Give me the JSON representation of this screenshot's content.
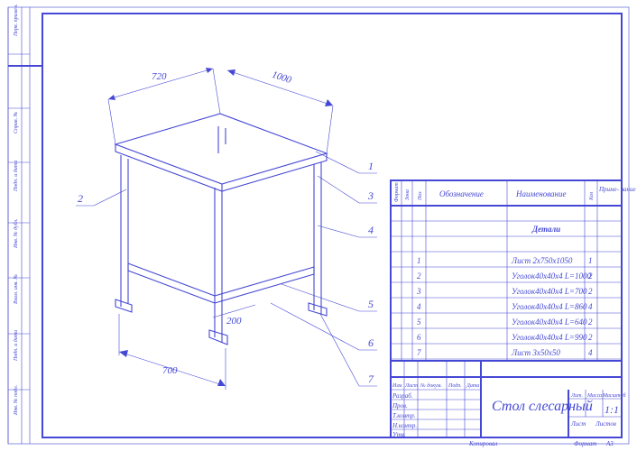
{
  "frame": {
    "format_label": "Формат",
    "format": "А3",
    "copy_label": "Копировал"
  },
  "dims": {
    "top_left": "720",
    "top_right": "1000",
    "bottom_short": "200",
    "bottom_long": "700"
  },
  "leaders": [
    "1",
    "2",
    "3",
    "4",
    "5",
    "6",
    "7"
  ],
  "bom": {
    "headers": {
      "format": "Формат",
      "zone": "Зона",
      "pos": "Поз",
      "designation": "Обозначение",
      "name": "Наименование",
      "qty": "Кол",
      "note": "Приме-\nчание"
    },
    "section": "Детали",
    "rows": [
      {
        "pos": "1",
        "name": "Лист 2х750х1050",
        "qty": "1"
      },
      {
        "pos": "2",
        "name": "Уголок40х40х4  L=1000",
        "qty": "2"
      },
      {
        "pos": "3",
        "name": "Уголок40х40х4  L=700",
        "qty": "2"
      },
      {
        "pos": "4",
        "name": "Уголок40х40х4  L=860",
        "qty": "4"
      },
      {
        "pos": "5",
        "name": "Уголок40х40х4  L=640",
        "qty": "2"
      },
      {
        "pos": "6",
        "name": "Уголок40х40х4  L=990",
        "qty": "2"
      },
      {
        "pos": "7",
        "name": "Лист 3х50х50",
        "qty": "4"
      }
    ]
  },
  "titleblock": {
    "rows": [
      "Изм",
      "Лист",
      "№ докум.",
      "Подп.",
      "Дата"
    ],
    "left": [
      "Разраб.",
      "Пров.",
      "Т.контр.",
      "Н.контр.",
      "Утв."
    ],
    "title": "Стол слесарный",
    "lit": "Лит.",
    "mass": "Масса",
    "scale": "Масштаб",
    "scale_val": "1:1",
    "sheet": "Лист",
    "sheets": "Листов"
  },
  "sidebar": [
    "Инв. № подл.",
    "Подп. и дата",
    "Взам. инв. №",
    "Инв. № дубл.",
    "Подп. и дата",
    "Справ. №",
    "Перв. примен."
  ]
}
